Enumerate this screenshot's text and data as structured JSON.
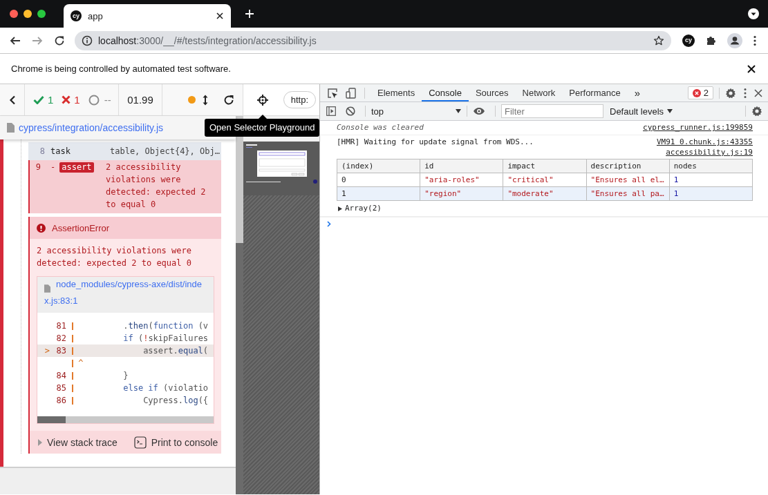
{
  "browser": {
    "tab": {
      "favicon": "cy",
      "title": "app"
    },
    "toolbar": {
      "forward_disabled": true,
      "url_host": "localhost",
      "url_rest": ":3000/__/#/tests/integration/accessibility.js",
      "extension": "cy"
    },
    "infobar": "Chrome is being controlled by automated test software."
  },
  "runner": {
    "stats": {
      "passed": "1",
      "failed": "1",
      "pending": "--"
    },
    "duration": "01.99",
    "spec_path": "cypress/integration/accessibility.js",
    "commands": [
      {
        "number": "8",
        "name": "task",
        "message": "table, Object{4}, Obj…",
        "failed": false
      },
      {
        "number": "9",
        "prefix": "-",
        "name": "assert",
        "message": "2 accessibility violations were detected: expected 2 to equal 0",
        "failed": true
      }
    ],
    "error": {
      "name": "AssertionError",
      "message": "2 accessibility violations were detected: expected 2 to equal 0",
      "file": "node_modules/cypress-axe/dist/index.js:83:1",
      "code_lines": [
        {
          "kind": "code",
          "number": "81",
          "tokens": [
            {
              "text": "          .",
              "kind": "plain"
            },
            {
              "text": "then",
              "kind": "function"
            },
            {
              "text": "(",
              "kind": "plain"
            },
            {
              "text": "function",
              "kind": "keyword"
            },
            {
              "text": " (v",
              "kind": "plain"
            }
          ]
        },
        {
          "kind": "code",
          "number": "82",
          "tokens": [
            {
              "text": "          if",
              "kind": "keyword"
            },
            {
              "text": " (",
              "kind": "plain"
            },
            {
              "text": "!",
              "kind": "operator"
            },
            {
              "text": "skipFailures",
              "kind": "plain"
            }
          ]
        },
        {
          "kind": "current",
          "marker": ">",
          "number": "83",
          "tokens": [
            {
              "text": "              assert.",
              "kind": "plain"
            },
            {
              "text": "equal",
              "kind": "function"
            },
            {
              "text": "(",
              "kind": "plain"
            }
          ]
        },
        {
          "kind": "caret",
          "tokens": [
            {
              "text": " ^",
              "kind": "caret"
            }
          ]
        },
        {
          "kind": "code",
          "number": "84",
          "tokens": [
            {
              "text": "          }",
              "kind": "plain"
            }
          ]
        },
        {
          "kind": "code",
          "number": "85",
          "tokens": [
            {
              "text": "          else if",
              "kind": "keyword"
            },
            {
              "text": " (violatio",
              "kind": "plain"
            }
          ]
        },
        {
          "kind": "code",
          "number": "86",
          "tokens": [
            {
              "text": "              Cypress.",
              "kind": "plain"
            },
            {
              "text": "log",
              "kind": "function"
            },
            {
              "text": "({",
              "kind": "plain"
            }
          ]
        }
      ],
      "actions": [
        "View stack trace",
        "Print to console"
      ]
    }
  },
  "preview": {
    "url": "http:",
    "tooltip": "Open Selector Playground"
  },
  "devtools": {
    "tabs": [
      {
        "label": "Elements",
        "selected": false
      },
      {
        "label": "Console",
        "selected": true
      },
      {
        "label": "Sources",
        "selected": false
      },
      {
        "label": "Network",
        "selected": false
      },
      {
        "label": "Performance",
        "selected": false
      }
    ],
    "more": "»",
    "error_count": "2",
    "console_toolbar": {
      "context": "top",
      "filter_placeholder": "Filter",
      "levels": "Default levels"
    },
    "messages": [
      {
        "kind": "info",
        "text": "Console was cleared",
        "source": "cypress_runner.js:199859"
      },
      {
        "kind": "log",
        "text": "[HMR] Waiting for update signal from WDS...",
        "source": "VM91 0.chunk.js:43355"
      }
    ],
    "table": {
      "source": "accessibility.js:19",
      "columns": [
        "(index)",
        "id",
        "impact",
        "description",
        "nodes"
      ],
      "rows": [
        [
          {
            "text": "0",
            "kind": "index"
          },
          {
            "text": "\"aria-roles\"",
            "kind": "string"
          },
          {
            "text": "\"critical\"",
            "kind": "string"
          },
          {
            "text": "\"Ensures all el…",
            "kind": "string"
          },
          {
            "text": "1",
            "kind": "number"
          }
        ],
        [
          {
            "text": "1",
            "kind": "index"
          },
          {
            "text": "\"region\"",
            "kind": "string"
          },
          {
            "text": "\"moderate\"",
            "kind": "string"
          },
          {
            "text": "\"Ensures all pa…",
            "kind": "string"
          },
          {
            "text": "1",
            "kind": "number"
          }
        ]
      ]
    },
    "array": {
      "label": "Array(2)",
      "expanded": false
    }
  }
}
